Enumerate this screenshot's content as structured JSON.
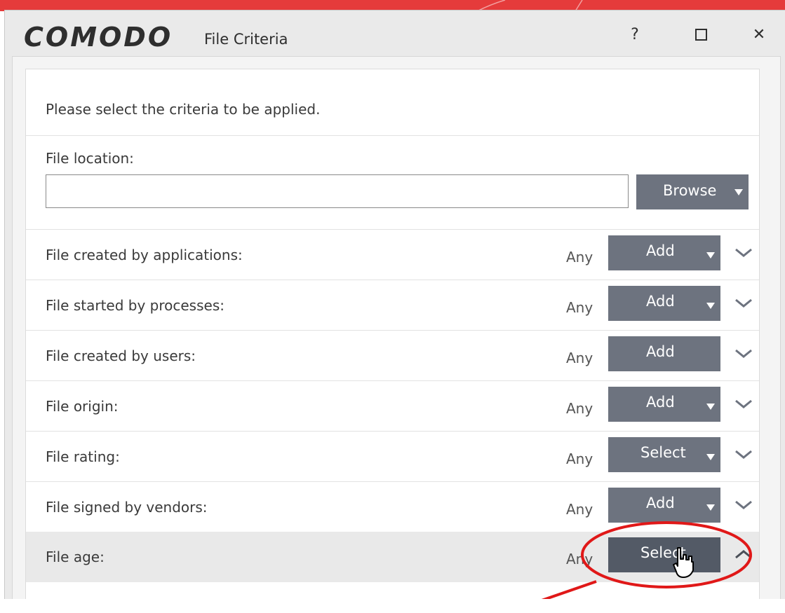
{
  "colors": {
    "brand_red": "#e53b3b",
    "button_bg": "#6d737f",
    "annotation": "#e01818"
  },
  "window": {
    "logo": "COMODO",
    "title": "File Criteria",
    "help_label": "?",
    "close_label": "✕"
  },
  "form": {
    "intro": "Please select the criteria to be applied.",
    "location_label": "File location:",
    "location_value": "",
    "browse_label": "Browse",
    "rows": [
      {
        "label": "File created by applications:",
        "value": "Any",
        "button": "Add"
      },
      {
        "label": "File started by processes:",
        "value": "Any",
        "button": "Add"
      },
      {
        "label": "File created by users:",
        "value": "Any",
        "button": "Add"
      },
      {
        "label": "File origin:",
        "value": "Any",
        "button": "Add"
      },
      {
        "label": "File rating:",
        "value": "Any",
        "button": "Select"
      },
      {
        "label": "File signed by vendors:",
        "value": "Any",
        "button": "Add"
      },
      {
        "label": "File age:",
        "value": "Any",
        "button": "Select"
      }
    ]
  },
  "icons": [
    "help-icon",
    "maximize-icon",
    "close-icon",
    "dropdown-arrow-icon",
    "chevron-down-icon",
    "chevron-up-icon",
    "hand-cursor-icon"
  ]
}
